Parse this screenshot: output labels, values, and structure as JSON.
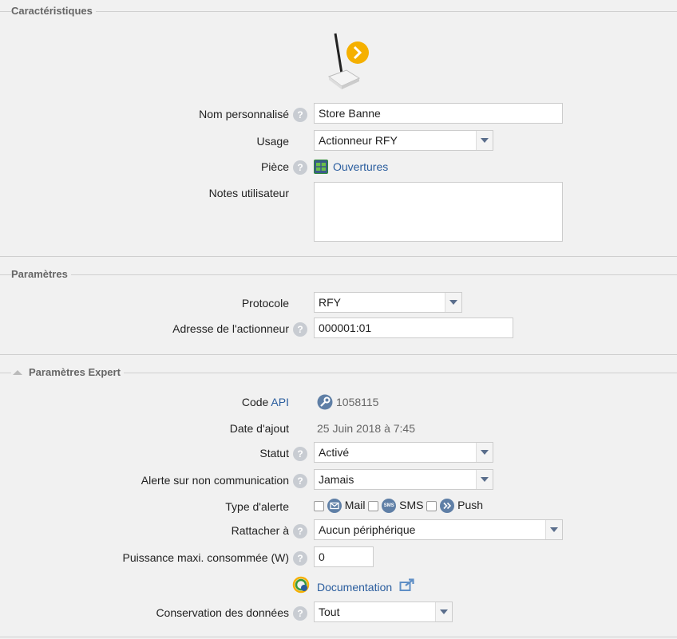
{
  "sections": {
    "caracteristiques": "Caractéristiques",
    "parametres": "Paramètres",
    "expert": "Paramètres Expert"
  },
  "fields": {
    "nom_label": "Nom personnalisé",
    "nom_value": "Store Banne",
    "usage_label": "Usage",
    "usage_value": "Actionneur RFY",
    "piece_label": "Pièce",
    "piece_value": "Ouvertures",
    "notes_label": "Notes utilisateur",
    "notes_value": "",
    "protocole_label": "Protocole",
    "protocole_value": "RFY",
    "adresse_label": "Adresse de l'actionneur",
    "adresse_value": "000001:01",
    "code_label": "Code",
    "code_api": "API",
    "code_value": "1058115",
    "date_label": "Date d'ajout",
    "date_value": "25 Juin 2018 à 7:45",
    "statut_label": "Statut",
    "statut_value": "Activé",
    "alerte_label": "Alerte sur non communication",
    "alerte_value": "Jamais",
    "type_alerte_label": "Type d'alerte",
    "type_mail": "Mail",
    "type_sms": "SMS",
    "type_push": "Push",
    "sms_badge": "SMS",
    "rattacher_label": "Rattacher à",
    "rattacher_value": "Aucun périphérique",
    "puissance_label": "Puissance maxi. consommée (W)",
    "puissance_value": "0",
    "documentation": "Documentation",
    "conservation_label": "Conservation des données",
    "conservation_value": "Tout"
  },
  "help_glyph": "?",
  "icons": {
    "device": "rfy-actuator-icon",
    "room": "room-icon",
    "key": "key-icon",
    "mail": "mail-icon",
    "sms": "sms-icon",
    "push": "push-icon",
    "doc": "documentation-icon",
    "external": "external-link-icon"
  },
  "colors": {
    "link": "#2a5d9e",
    "accent": "#f5b000",
    "background": "#f1f1f1"
  }
}
